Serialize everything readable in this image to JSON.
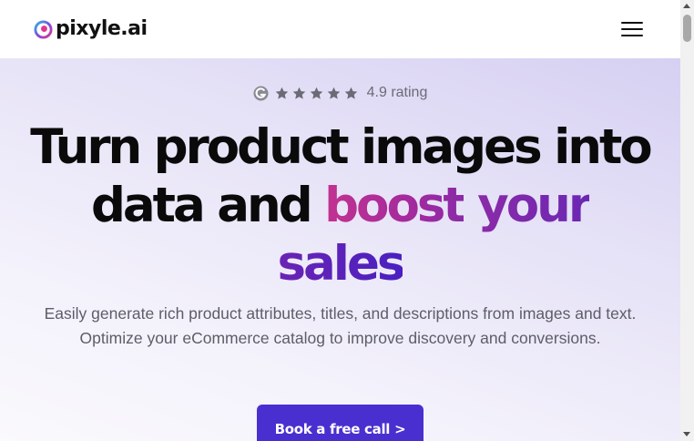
{
  "header": {
    "logo_text": "pixyle.ai",
    "logo_icon": "pixyle-logo-icon",
    "menu_icon": "hamburger-menu-icon"
  },
  "hero": {
    "rating": {
      "source_icon": "g2-icon",
      "stars": 5,
      "label": "4.9 rating"
    },
    "headline": {
      "line1": "Turn product images into",
      "line2_plain": "data and ",
      "line2_accent1": "boost",
      "line2_space": " ",
      "line2_accent2": "your",
      "line3_accent": "sales"
    },
    "subtext": "Easily generate rich product attributes, titles, and descriptions from images and text. Optimize your eCommerce catalog to improve discovery and conversions.",
    "cta": {
      "label": "Book a free call",
      "chevron": ">"
    }
  },
  "colors": {
    "brand_purple": "#4a2fd0",
    "accent_pink": "#c2338f",
    "accent_violet": "#6a24b4",
    "hero_bg": "#e6e2f7",
    "star_gray": "#6b6b76"
  }
}
